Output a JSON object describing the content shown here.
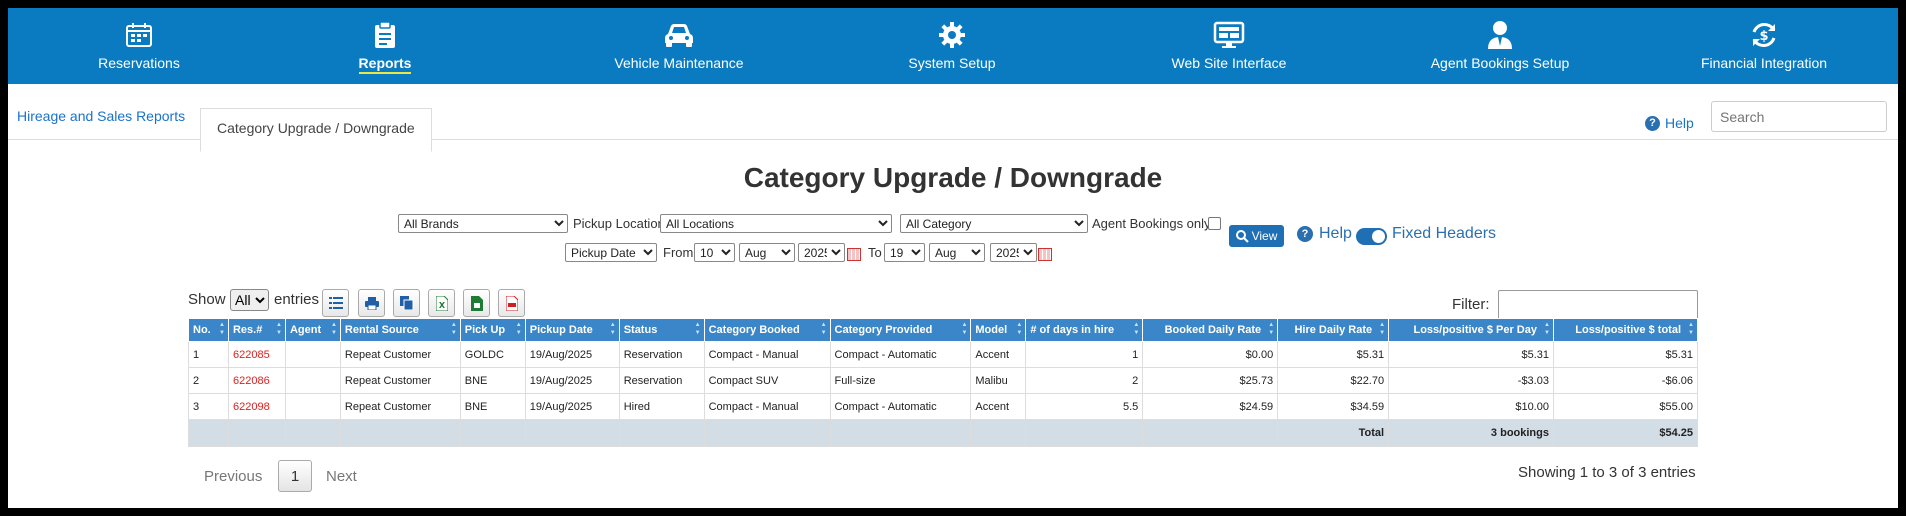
{
  "nav": [
    {
      "label": "Reservations",
      "icon": "calendar-icon"
    },
    {
      "label": "Reports",
      "icon": "clipboard-icon",
      "active": true
    },
    {
      "label": "Vehicle Maintenance",
      "icon": "car-icon"
    },
    {
      "label": "System Setup",
      "icon": "gear-icon"
    },
    {
      "label": "Web Site Interface",
      "icon": "monitor-icon"
    },
    {
      "label": "Agent Bookings Setup",
      "icon": "user-icon"
    },
    {
      "label": "Financial Integration",
      "icon": "dollar-sync-icon"
    }
  ],
  "tabs": {
    "link": "Hireage and Sales Reports",
    "current": "Category Upgrade / Downgrade"
  },
  "top": {
    "help": "Help",
    "search_placeholder": "Search"
  },
  "page_title": "Category Upgrade / Downgrade",
  "filters": {
    "brand": "All Brands",
    "pickup_location_label": "Pickup Location",
    "location": "All Locations",
    "category": "All Category",
    "agent_only_label": "Agent Bookings only",
    "date_type": "Pickup Date",
    "from_label": "From",
    "from_day": "10",
    "from_month": "Aug",
    "from_year": "2025",
    "to_label": "To",
    "to_day": "19",
    "to_month": "Aug",
    "to_year": "2025",
    "view_label": "View",
    "help_label": "Help",
    "fixed_headers_label": "Fixed Headers"
  },
  "show": {
    "show_label": "Show",
    "value": "All",
    "entries_label": "entries",
    "filter_label": "Filter:"
  },
  "columns": [
    "No.",
    "Res.#",
    "Agent",
    "Rental Source",
    "Pick Up",
    "Pickup Date",
    "Status",
    "Category Booked",
    "Category Provided",
    "Model",
    "# of days in hire",
    "Booked Daily Rate",
    "Hire Daily Rate",
    "Loss/positive $ Per Day",
    "Loss/positive $ total"
  ],
  "rows": [
    [
      "1",
      "622085",
      "",
      "Repeat Customer",
      "GOLDC",
      "19/Aug/2025",
      "Reservation",
      "Compact - Manual",
      "Compact - Automatic",
      "Accent",
      "1",
      "$0.00",
      "$5.31",
      "$5.31",
      "$5.31"
    ],
    [
      "2",
      "622086",
      "",
      "Repeat Customer",
      "BNE",
      "19/Aug/2025",
      "Reservation",
      "Compact SUV",
      "Full-size",
      "Malibu",
      "2",
      "$25.73",
      "$22.70",
      "-$3.03",
      "-$6.06"
    ],
    [
      "3",
      "622098",
      "",
      "Repeat Customer",
      "BNE",
      "19/Aug/2025",
      "Hired",
      "Compact - Manual",
      "Compact - Automatic",
      "Accent",
      "5.5",
      "$24.59",
      "$34.59",
      "$10.00",
      "$55.00"
    ]
  ],
  "totals": {
    "label": "Total",
    "bookings": "3 bookings",
    "sum": "$54.25"
  },
  "pagination": {
    "previous": "Previous",
    "page": "1",
    "next": "Next",
    "info": "Showing 1 to 3 of 3 entries"
  }
}
